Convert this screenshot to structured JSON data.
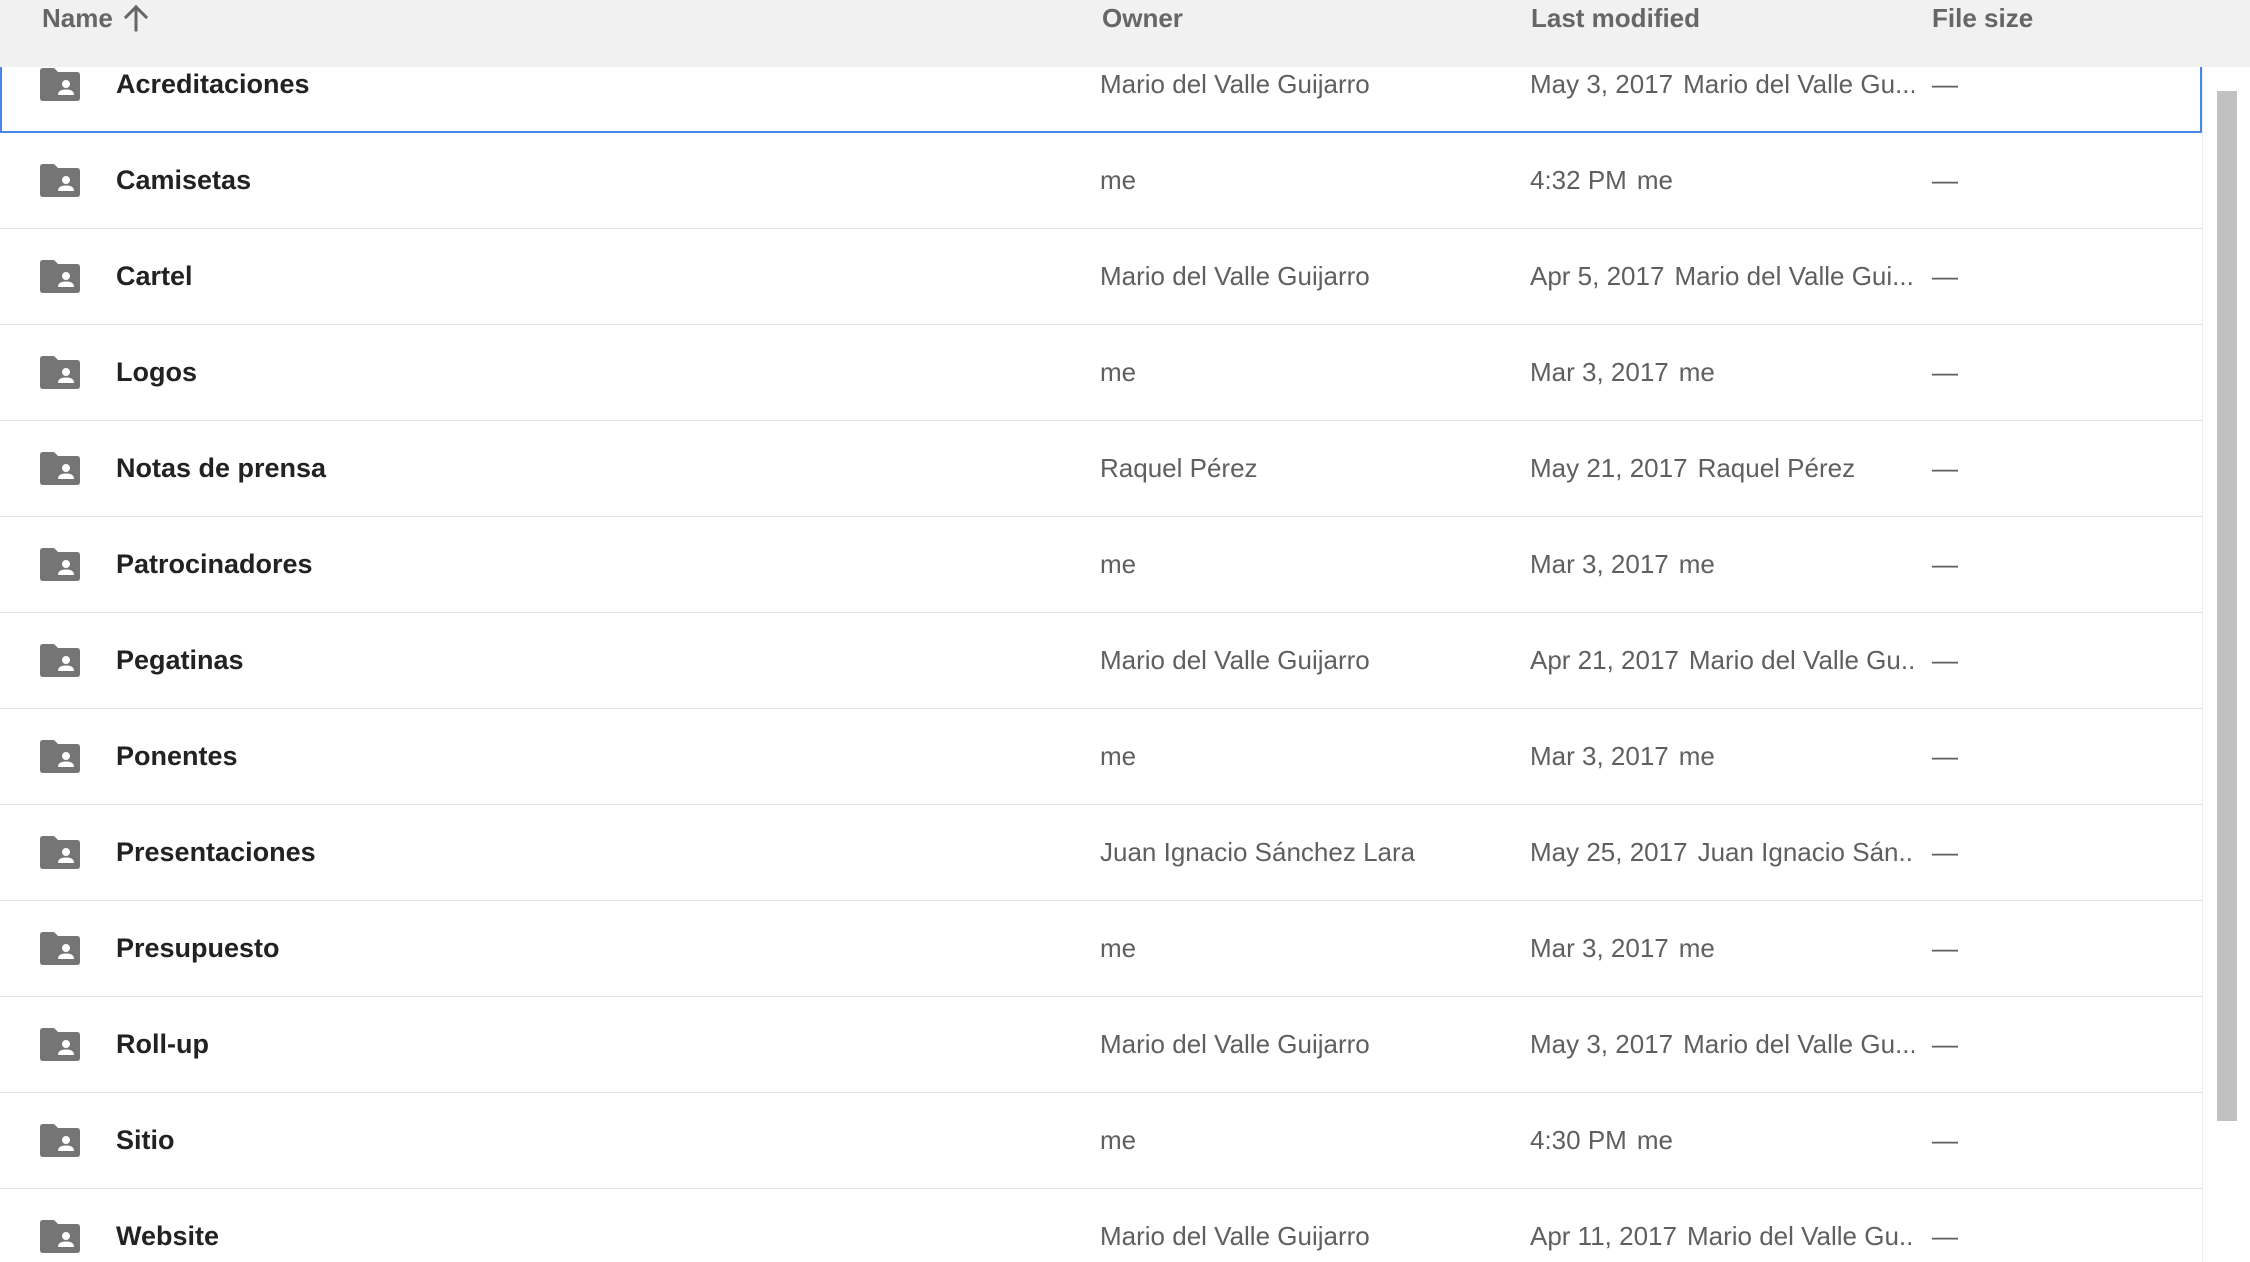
{
  "header": {
    "name_label": "Name",
    "owner_label": "Owner",
    "modified_label": "Last modified",
    "size_label": "File size",
    "sort_icon": "arrow-up-icon"
  },
  "rows": [
    {
      "name": "Acreditaciones",
      "owner": "Mario del Valle Guijarro",
      "modified_date": "May 3, 2017",
      "modified_by": "Mario del Valle Gu...",
      "size": "—",
      "selected": true
    },
    {
      "name": "Camisetas",
      "owner": "me",
      "modified_date": "4:32 PM",
      "modified_by": "me",
      "size": "—"
    },
    {
      "name": "Cartel",
      "owner": "Mario del Valle Guijarro",
      "modified_date": "Apr 5, 2017",
      "modified_by": "Mario del Valle Gui...",
      "size": "—"
    },
    {
      "name": "Logos",
      "owner": "me",
      "modified_date": "Mar 3, 2017",
      "modified_by": "me",
      "size": "—"
    },
    {
      "name": "Notas de prensa",
      "owner": "Raquel Pérez",
      "modified_date": "May 21, 2017",
      "modified_by": "Raquel Pérez",
      "size": "—"
    },
    {
      "name": "Patrocinadores",
      "owner": "me",
      "modified_date": "Mar 3, 2017",
      "modified_by": "me",
      "size": "—"
    },
    {
      "name": "Pegatinas",
      "owner": "Mario del Valle Guijarro",
      "modified_date": "Apr 21, 2017",
      "modified_by": "Mario del Valle Gu...",
      "size": "—"
    },
    {
      "name": "Ponentes",
      "owner": "me",
      "modified_date": "Mar 3, 2017",
      "modified_by": "me",
      "size": "—"
    },
    {
      "name": "Presentaciones",
      "owner": "Juan Ignacio Sánchez Lara",
      "modified_date": "May 25, 2017",
      "modified_by": "Juan Ignacio Sán...",
      "size": "—"
    },
    {
      "name": "Presupuesto",
      "owner": "me",
      "modified_date": "Mar 3, 2017",
      "modified_by": "me",
      "size": "—"
    },
    {
      "name": "Roll-up",
      "owner": "Mario del Valle Guijarro",
      "modified_date": "May 3, 2017",
      "modified_by": "Mario del Valle Gu...",
      "size": "—"
    },
    {
      "name": "Sitio",
      "owner": "me",
      "modified_date": "4:30 PM",
      "modified_by": "me",
      "size": "—"
    },
    {
      "name": "Website",
      "owner": "Mario del Valle Guijarro",
      "modified_date": "Apr 11, 2017",
      "modified_by": "Mario del Valle Gu...",
      "size": "—"
    }
  ],
  "row_icon": "shared-folder-icon",
  "colors": {
    "header_bg": "#f1f1f1",
    "selected_outline": "#4a86e8",
    "icon": "#757575",
    "divider": "#e3e3e3"
  }
}
